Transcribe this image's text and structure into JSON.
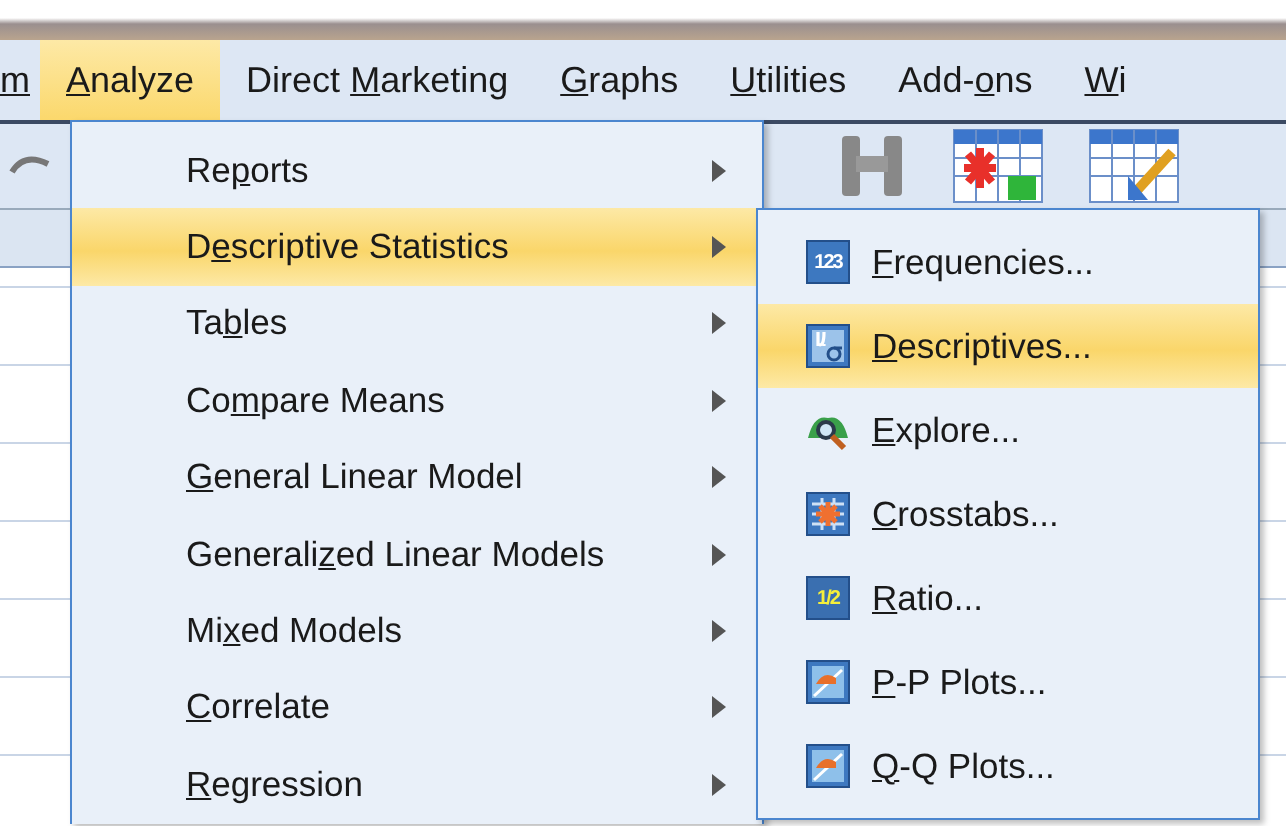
{
  "menubar": [
    {
      "label": {
        "key": "m"
      },
      "selected": false
    },
    {
      "label": {
        "key": "A",
        "post": "nalyze"
      },
      "selected": true
    },
    {
      "label": {
        "pre": "Direct ",
        "key": "M",
        "post": "arketing"
      },
      "selected": false
    },
    {
      "label": {
        "key": "G",
        "post": "raphs"
      },
      "selected": false
    },
    {
      "label": {
        "key": "U",
        "post": "tilities"
      },
      "selected": false
    },
    {
      "label": {
        "pre": "Add-",
        "key": "o",
        "post": "ns"
      },
      "selected": false
    },
    {
      "label": {
        "key": "W",
        "post": "i"
      },
      "selected": false
    }
  ],
  "analyze_menu": [
    {
      "label": {
        "pre": "Re",
        "key": "p",
        "post": "orts"
      },
      "selected": false
    },
    {
      "label": {
        "pre": "D",
        "key": "e",
        "post": "scriptive Statistics"
      },
      "selected": true
    },
    {
      "label": {
        "pre": "Ta",
        "key": "b",
        "post": "les"
      },
      "selected": false
    },
    {
      "label": {
        "pre": "Co",
        "key": "m",
        "post": "pare Means"
      },
      "selected": false
    },
    {
      "label": {
        "key": "G",
        "post": "eneral Linear Model"
      },
      "selected": false
    },
    {
      "label": {
        "pre": "Generali",
        "key": "z",
        "post": "ed Linear Models"
      },
      "selected": false
    },
    {
      "label": {
        "pre": "Mi",
        "key": "x",
        "post": "ed Models"
      },
      "selected": false
    },
    {
      "label": {
        "key": "C",
        "post": "orrelate"
      },
      "selected": false
    },
    {
      "label": {
        "key": "R",
        "post": "egression"
      },
      "selected": false
    }
  ],
  "descriptive_statistics_submenu": [
    {
      "kind": "numbers",
      "icon_text": "123",
      "label": {
        "key": "F",
        "post": "requencies..."
      },
      "selected": false
    },
    {
      "kind": "mu",
      "label": {
        "key": "D",
        "post": "escriptives..."
      },
      "selected": true
    },
    {
      "kind": "explore",
      "label": {
        "key": "E",
        "post": "xplore..."
      },
      "selected": false
    },
    {
      "kind": "crosstab",
      "label": {
        "key": "C",
        "post": "rosstabs..."
      },
      "selected": false
    },
    {
      "kind": "numbers",
      "icon_text": "1/2",
      "label": {
        "key": "R",
        "post": "atio..."
      },
      "selected": false
    },
    {
      "kind": "plot",
      "label": {
        "key": "P",
        "post": "-P Plots..."
      },
      "selected": false
    },
    {
      "kind": "plot",
      "label": {
        "key": "Q",
        "post": "-Q Plots..."
      },
      "selected": false
    }
  ]
}
